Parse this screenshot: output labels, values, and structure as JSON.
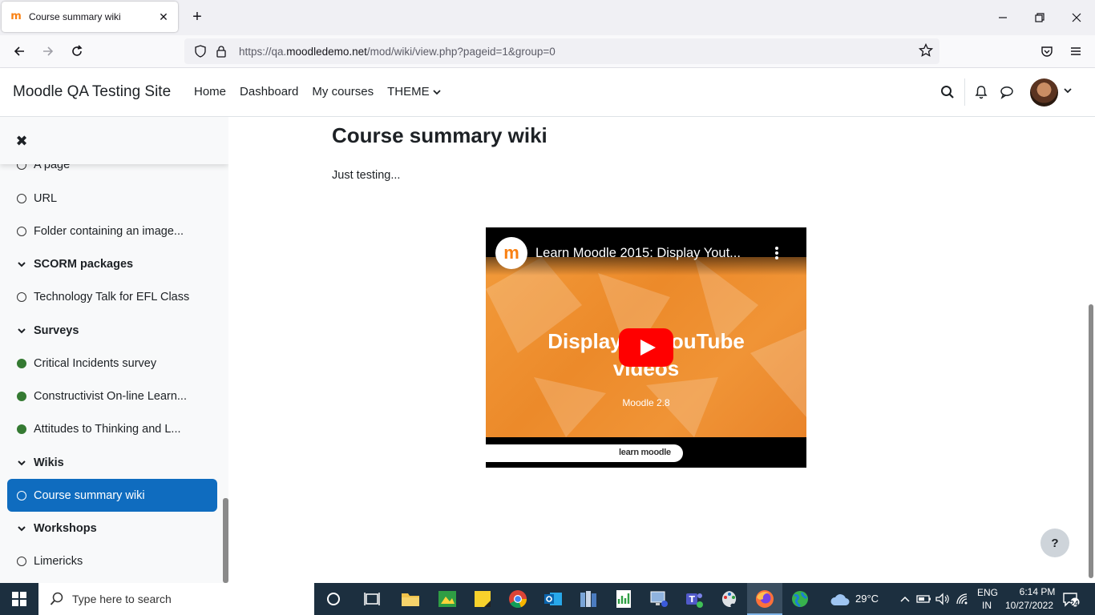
{
  "browser": {
    "tab_title": "Course summary wiki",
    "url_prefix": "https://qa.",
    "url_domain": "moodledemo.net",
    "url_path": "/mod/wiki/view.php?pageid=1&group=0"
  },
  "header": {
    "site_name": "Moodle QA Testing Site",
    "nav": [
      "Home",
      "Dashboard",
      "My courses",
      "THEME"
    ]
  },
  "course_index": {
    "items": [
      {
        "label": "A page",
        "kind": "activity",
        "done": false
      },
      {
        "label": "URL",
        "kind": "activity",
        "done": false
      },
      {
        "label": "Folder containing an image...",
        "kind": "activity",
        "done": false
      },
      {
        "label": "SCORM packages",
        "kind": "section"
      },
      {
        "label": "Technology Talk for EFL Class",
        "kind": "activity",
        "done": false
      },
      {
        "label": "Surveys",
        "kind": "section"
      },
      {
        "label": "Critical Incidents survey",
        "kind": "activity",
        "done": true
      },
      {
        "label": "Constructivist On-line Learn...",
        "kind": "activity",
        "done": true
      },
      {
        "label": "Attitudes to Thinking and L...",
        "kind": "activity",
        "done": true
      },
      {
        "label": "Wikis",
        "kind": "section"
      },
      {
        "label": "Course summary wiki",
        "kind": "activity",
        "done": false,
        "active": true
      },
      {
        "label": "Workshops",
        "kind": "section"
      },
      {
        "label": "Limericks",
        "kind": "activity",
        "done": false
      }
    ]
  },
  "main": {
    "heading": "Course summary wiki",
    "body_text": "Just testing...",
    "video": {
      "title": "Learn Moodle 2015: Display Yout...",
      "thumb_line1": "Displaying YouTube",
      "thumb_line2": "videos",
      "thumb_sub": "Moodle 2.8",
      "brand": "learn moodle"
    },
    "help_label": "?"
  },
  "taskbar": {
    "search_placeholder": "Type here to search",
    "weather": "29°C",
    "lang_top": "ENG",
    "lang_bottom": "IN",
    "time": "6:14 PM",
    "date": "10/27/2022",
    "notifications": "24"
  },
  "colors": {
    "moodle_orange": "#f98012",
    "active_blue": "#0f6cbf",
    "complete_green": "#357a32",
    "taskbar": "#1c2f3f"
  }
}
